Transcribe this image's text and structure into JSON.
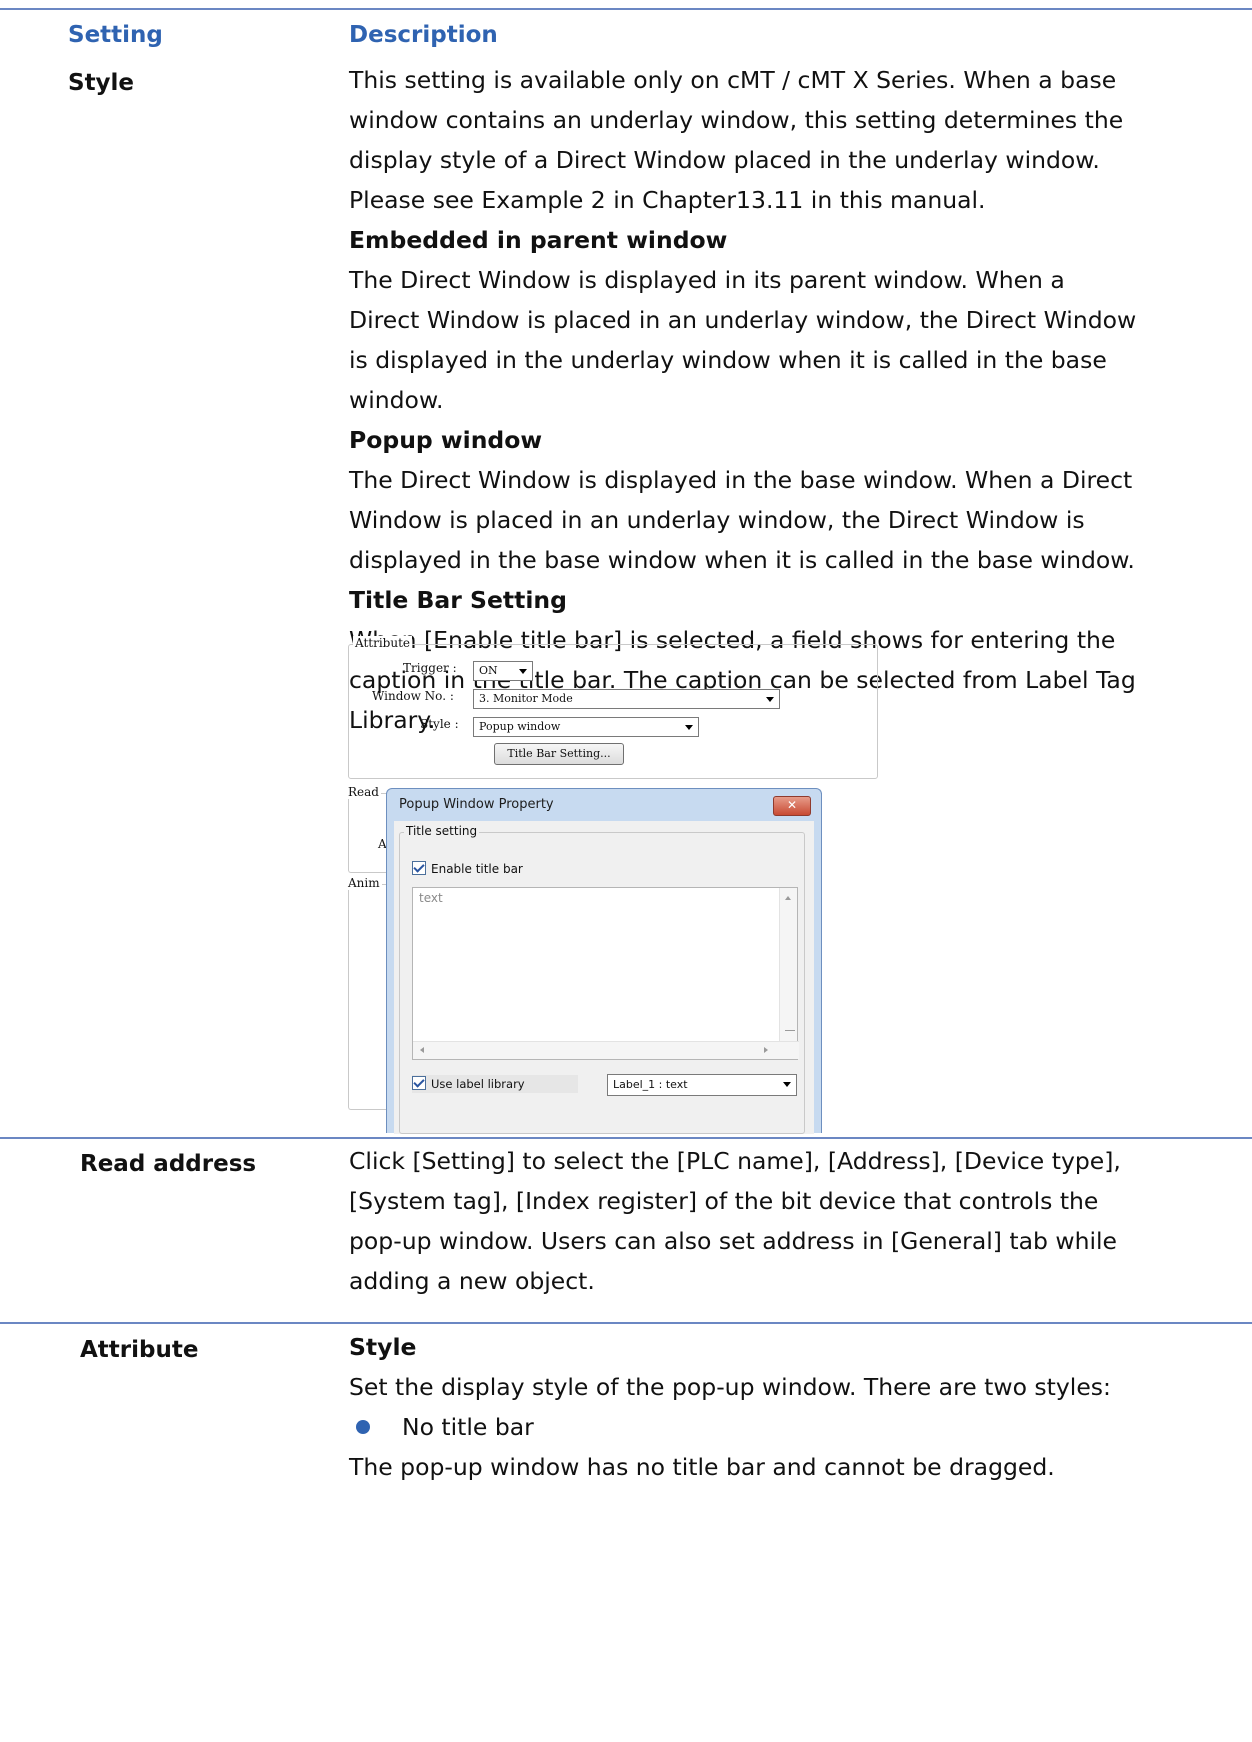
{
  "header": {
    "col1": "Setting",
    "col2": "Description"
  },
  "rows": {
    "style": {
      "label": "Style",
      "lines": [
        "This setting is available only on cMT / cMT X Series. When a base",
        "window contains an underlay window, this setting determines the",
        "display style of a Direct Window placed in the underlay window.",
        "Please see Example 2 in Chapter13.11 in this manual."
      ],
      "embedded_heading": "Embedded in parent window",
      "embedded_lines": [
        "The Direct Window is displayed in its parent window. When a",
        "Direct Window is placed in an underlay window, the Direct Window",
        "is displayed in the underlay window when it is called in the base",
        "window."
      ],
      "popup_heading": "Popup window",
      "popup_lines": [
        "The Direct Window is displayed in the base window. When a Direct",
        "Window is placed in an underlay window, the Direct Window is",
        "displayed in the base window when it is called in the base window."
      ],
      "titlebar_heading": "Title Bar Setting",
      "titlebar_lines": [
        "When [Enable title bar] is selected, a field shows for entering the",
        "caption in the title bar. The caption can be selected from Label Tag",
        "Library."
      ]
    },
    "read_address": {
      "label": "Read address",
      "lines": [
        "Click [Setting] to select the [PLC name], [Address], [Device type],",
        "[System tag], [Index register] of the bit device that controls the",
        "pop-up window. Users can also set address in [General] tab while",
        "adding a new object."
      ]
    },
    "attribute": {
      "label": "Attribute",
      "heading": "Style",
      "line1": "Set the display style of the pop-up window. There are two styles:",
      "bullet1": "No title bar",
      "line2": "The pop-up window has no title bar and cannot be dragged."
    }
  },
  "figure": {
    "attribute_group": "Attribute",
    "trigger_label": "Trigger :",
    "trigger_value": "ON",
    "window_no_label": "Window No. :",
    "window_no_value": "3. Monitor Mode",
    "style_label": "Style :",
    "style_value": "Popup window",
    "title_bar_button": "Title Bar Setting...",
    "read_group": "Read",
    "read_group_letter": "A",
    "anim_group": "Anim",
    "dialog_title": "Popup Window Property",
    "dialog_close": "✕",
    "title_setting_group": "Title setting",
    "enable_title_bar": "Enable title bar",
    "text_content": "text",
    "use_label_library": "Use label library",
    "label_combo_value": "Label_1 : text"
  }
}
